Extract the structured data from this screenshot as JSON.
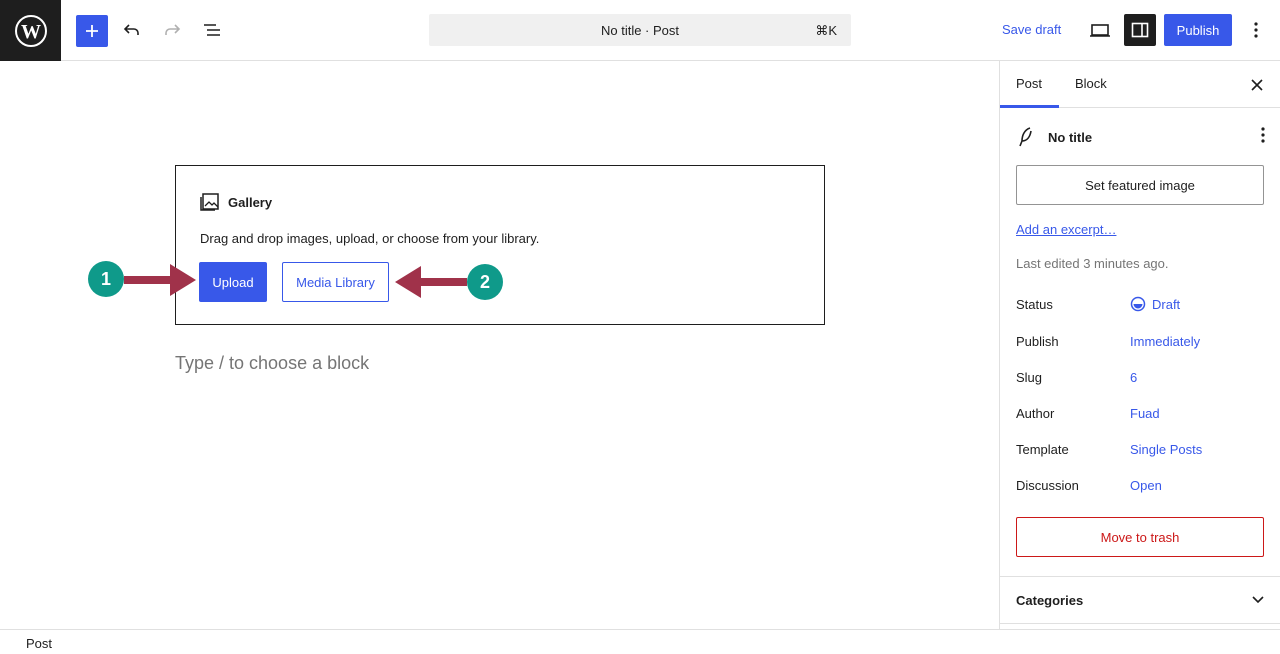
{
  "header": {
    "doc_title": "No title · Post",
    "shortcut": "⌘K",
    "save_draft": "Save draft",
    "publish": "Publish",
    "icons": [
      "wordpress-logo",
      "plus-icon",
      "undo-icon",
      "redo-icon",
      "list-view-icon",
      "view-icon",
      "sidebar-toggle-icon",
      "more-options-icon"
    ]
  },
  "editor": {
    "gallery": {
      "title": "Gallery",
      "instructions": "Drag and drop images, upload, or choose from your library.",
      "upload": "Upload",
      "media_library": "Media Library"
    },
    "block_placeholder": "Type / to choose a block",
    "annotations": [
      "1",
      "2"
    ]
  },
  "sidebar": {
    "tabs": [
      "Post",
      "Block"
    ],
    "post_title": "No title",
    "featured_image": "Set featured image",
    "excerpt": "Add an excerpt…",
    "last_edited": "Last edited 3 minutes ago.",
    "meta": [
      {
        "label": "Status",
        "value": "Draft"
      },
      {
        "label": "Publish",
        "value": "Immediately"
      },
      {
        "label": "Slug",
        "value": "6"
      },
      {
        "label": "Author",
        "value": "Fuad"
      },
      {
        "label": "Template",
        "value": "Single Posts"
      },
      {
        "label": "Discussion",
        "value": "Open"
      }
    ],
    "trash": "Move to trash",
    "categories": "Categories"
  },
  "footer": {
    "breadcrumb": "Post"
  },
  "colors": {
    "accent": "#3858e9",
    "danger": "#cc1818",
    "badge": "#0f9a8a",
    "arrow": "#a0324a"
  }
}
